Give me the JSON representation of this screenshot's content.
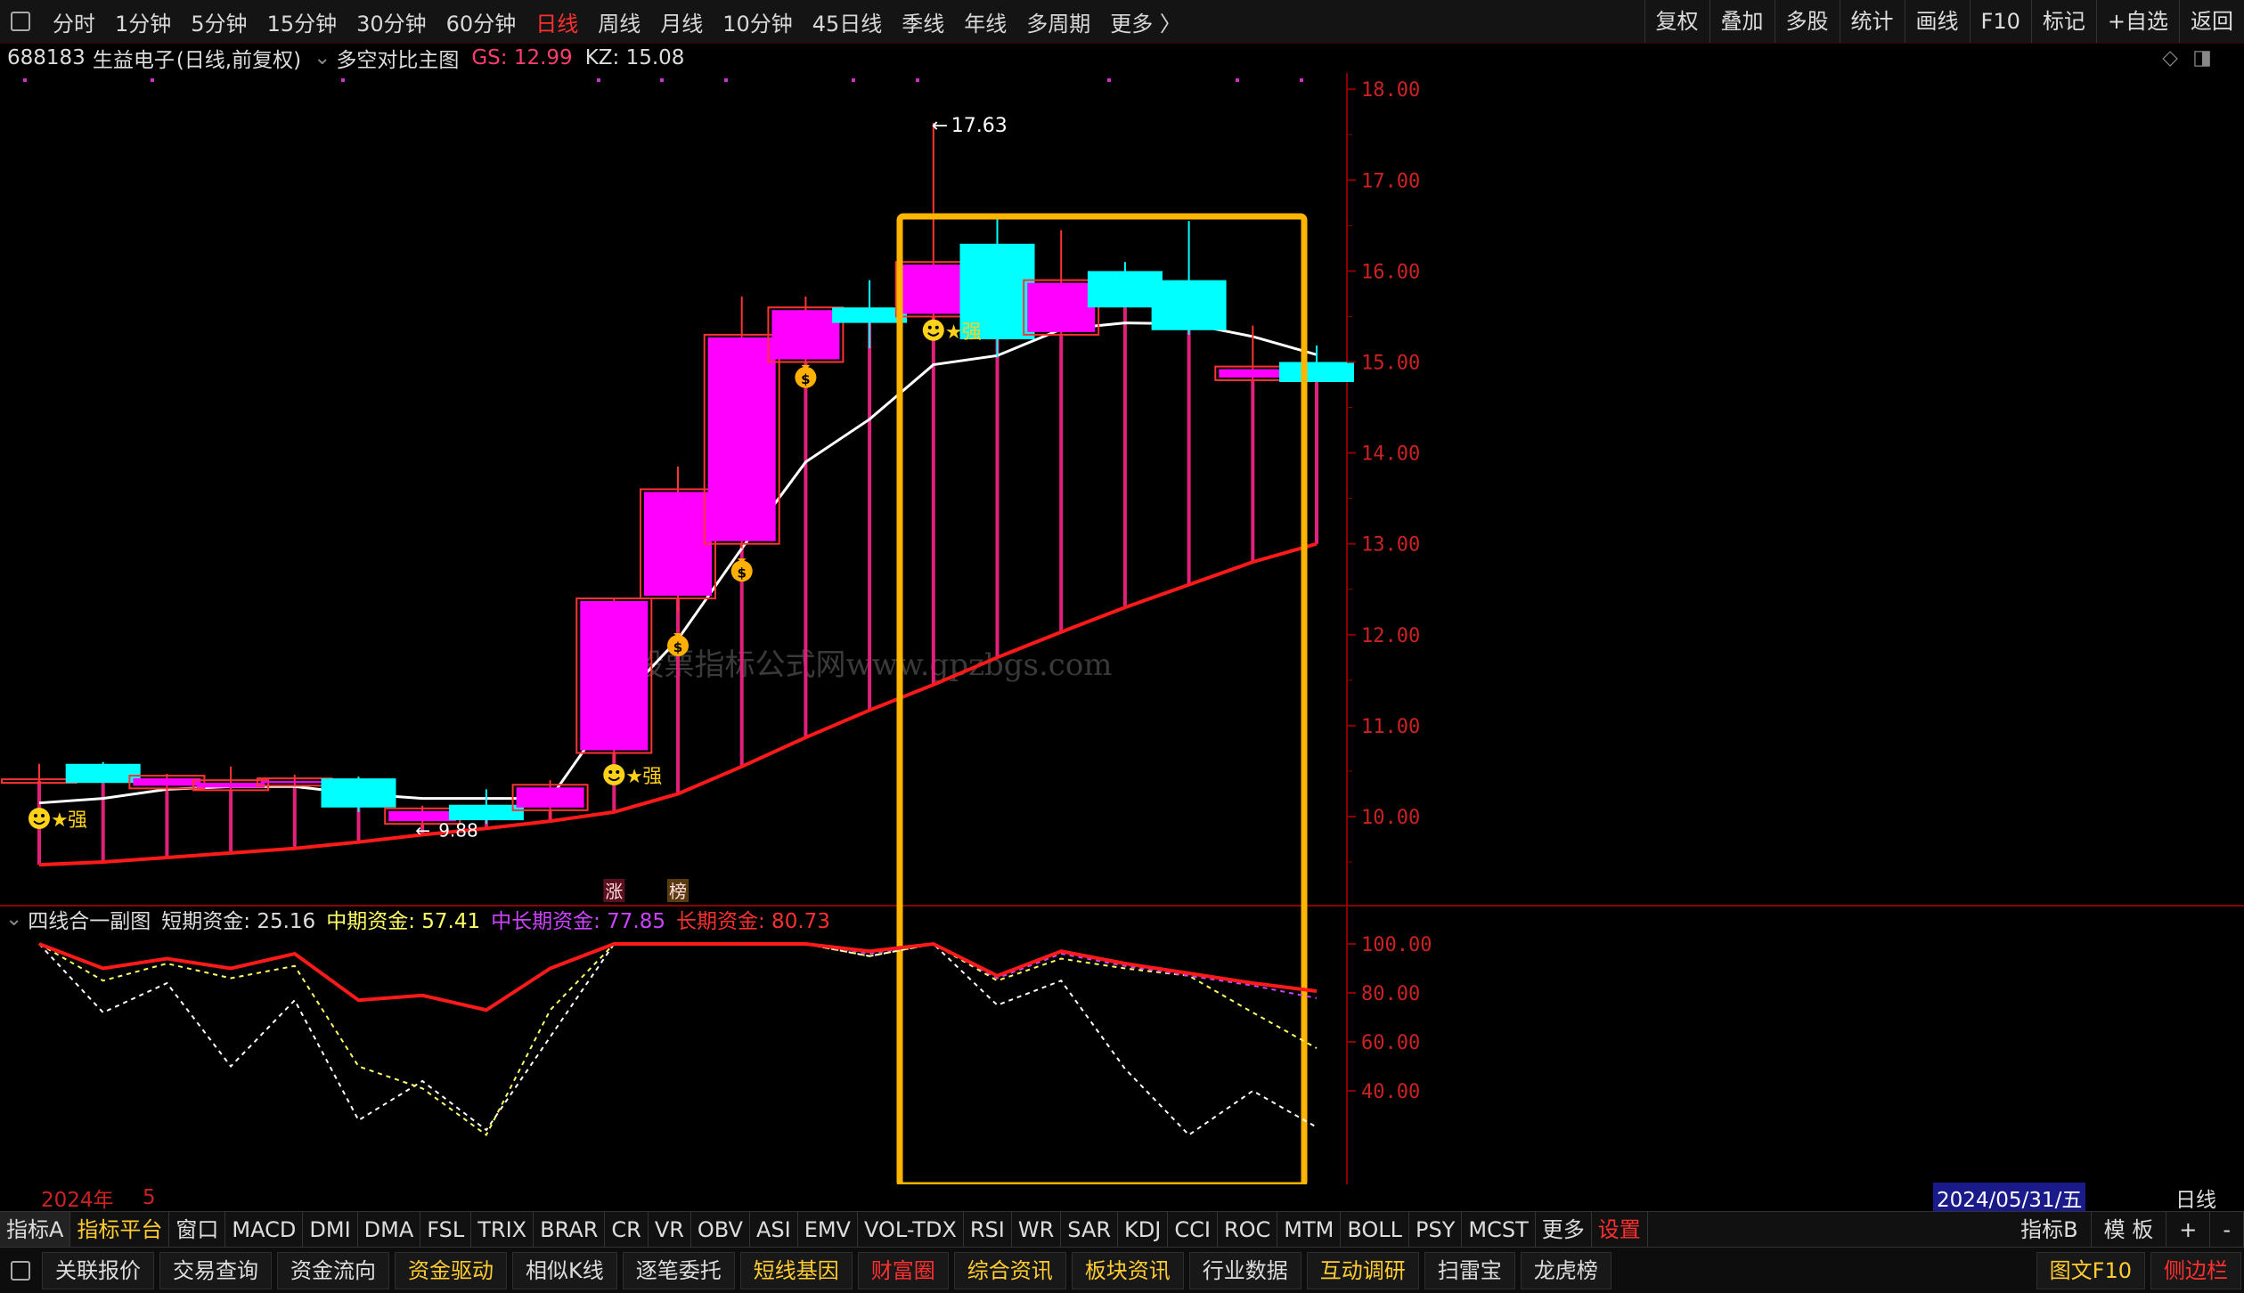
{
  "topbar": {
    "periods": [
      "分时",
      "1分钟",
      "5分钟",
      "15分钟",
      "30分钟",
      "60分钟",
      "日线",
      "周线",
      "月线",
      "10分钟",
      "45日线",
      "季线",
      "年线",
      "多周期",
      "更多 〉"
    ],
    "active_index": 6,
    "right": [
      "复权",
      "叠加",
      "多股",
      "统计",
      "画线",
      "F10",
      "标记",
      "+自选",
      "返回"
    ]
  },
  "info": {
    "code": "688183",
    "name": "生益电子",
    "mode": "(日线,前复权)",
    "indicator": "多空对比主图",
    "gs": "GS: 12.99",
    "kz": "KZ: 15.08"
  },
  "annotations": {
    "high_label": "17.63",
    "low_label": "9.88",
    "qiang": "强",
    "zhang": "涨",
    "bang": "榜",
    "watermark": "股票指标公式网www.gpzbgs.com"
  },
  "subinfo": {
    "name": "四线合一副图",
    "s1": "短期资金: 25.16",
    "s2": "中期资金: 57.41",
    "s3": "中长期资金: 77.85",
    "s4": "长期资金: 80.73"
  },
  "datebar": {
    "year": "2024年",
    "month": "5",
    "current": "2024/05/31/五",
    "period": "日线"
  },
  "tabs": [
    "指标A",
    "指标平台",
    "窗口",
    "MACD",
    "DMI",
    "DMA",
    "FSL",
    "TRIX",
    "BRAR",
    "CR",
    "VR",
    "OBV",
    "ASI",
    "EMV",
    "VOL-TDX",
    "RSI",
    "WR",
    "SAR",
    "KDJ",
    "CCI",
    "ROC",
    "MTM",
    "BOLL",
    "PSY",
    "MCST",
    "更多",
    "设置"
  ],
  "tabs_right": [
    "指标B",
    "模 板",
    "+",
    "-"
  ],
  "bottom_buttons": [
    "关联报价",
    "交易查询",
    "资金流向",
    "资金驱动",
    "相似K线",
    "逐笔委托",
    "短线基因",
    "财富圈",
    "综合资讯",
    "板块资讯",
    "行业数据",
    "互动调研",
    "扫雷宝",
    "龙虎榜"
  ],
  "bottom_right": [
    "图文F10",
    "侧边栏"
  ],
  "chart_data": {
    "type": "candlestick",
    "y_axis_main": [
      18,
      17,
      16,
      15,
      14,
      13,
      12,
      11,
      10
    ],
    "y_axis_sub": [
      100,
      80,
      60,
      40
    ],
    "candles": [
      {
        "o": 10.39,
        "h": 10.58,
        "l": 10.35,
        "c": 10.41,
        "dir": "up"
      },
      {
        "o": 10.58,
        "h": 10.6,
        "l": 10.37,
        "c": 10.37,
        "dir": "down"
      },
      {
        "o": 10.31,
        "h": 10.47,
        "l": 10.28,
        "c": 10.45,
        "dir": "up"
      },
      {
        "o": 10.29,
        "h": 10.55,
        "l": 10.28,
        "c": 10.4,
        "dir": "up"
      },
      {
        "o": 10.34,
        "h": 10.46,
        "l": 10.33,
        "c": 10.42,
        "dir": "up"
      },
      {
        "o": 10.42,
        "h": 10.44,
        "l": 10.05,
        "c": 10.1,
        "dir": "down"
      },
      {
        "o": 9.92,
        "h": 10.12,
        "l": 9.88,
        "c": 10.09,
        "dir": "up"
      },
      {
        "o": 10.13,
        "h": 10.3,
        "l": 9.92,
        "c": 9.96,
        "dir": "down"
      },
      {
        "o": 10.07,
        "h": 10.4,
        "l": 9.98,
        "c": 10.35,
        "dir": "up"
      },
      {
        "o": 10.7,
        "h": 12.4,
        "l": 10.6,
        "c": 12.4,
        "dir": "up"
      },
      {
        "o": 12.4,
        "h": 13.85,
        "l": 12.25,
        "c": 13.6,
        "dir": "up"
      },
      {
        "o": 13.0,
        "h": 15.72,
        "l": 12.95,
        "c": 15.3,
        "dir": "up"
      },
      {
        "o": 15.0,
        "h": 15.72,
        "l": 15.0,
        "c": 15.6,
        "dir": "up"
      },
      {
        "o": 15.6,
        "h": 15.9,
        "l": 15.15,
        "c": 15.43,
        "dir": "down"
      },
      {
        "o": 15.5,
        "h": 17.63,
        "l": 15.45,
        "c": 16.1,
        "dir": "up"
      },
      {
        "o": 16.3,
        "h": 16.6,
        "l": 15.05,
        "c": 15.25,
        "dir": "down"
      },
      {
        "o": 15.3,
        "h": 16.45,
        "l": 15.3,
        "c": 15.9,
        "dir": "up"
      },
      {
        "o": 16.0,
        "h": 16.1,
        "l": 15.6,
        "c": 15.6,
        "dir": "down"
      },
      {
        "o": 15.9,
        "h": 16.55,
        "l": 15.3,
        "c": 15.35,
        "dir": "down"
      },
      {
        "o": 14.8,
        "h": 15.4,
        "l": 14.8,
        "c": 14.95,
        "dir": "up"
      },
      {
        "o": 15.0,
        "h": 15.18,
        "l": 14.78,
        "c": 14.78,
        "dir": "down"
      }
    ],
    "white_line": [
      10.15,
      10.2,
      10.3,
      10.33,
      10.33,
      10.25,
      10.2,
      10.2,
      10.2,
      11.2,
      11.95,
      12.95,
      13.9,
      14.37,
      14.97,
      15.07,
      15.36,
      15.43,
      15.42,
      15.28,
      15.08
    ],
    "red_line": [
      9.47,
      9.5,
      9.55,
      9.6,
      9.65,
      9.72,
      9.8,
      9.87,
      9.95,
      10.05,
      10.25,
      10.55,
      10.87,
      11.17,
      11.45,
      11.75,
      12.03,
      12.3,
      12.55,
      12.8,
      13.0
    ],
    "icons": [
      {
        "i": 0,
        "type": "smile",
        "v": 9.98
      },
      {
        "i": 9,
        "type": "smile",
        "v": 10.46
      },
      {
        "i": 10,
        "type": "bag",
        "v": 11.9
      },
      {
        "i": 11,
        "type": "bag",
        "v": 12.72
      },
      {
        "i": 12,
        "type": "bag",
        "v": 14.85
      },
      {
        "i": 14,
        "type": "smile",
        "v": 15.35
      }
    ],
    "sub_red": [
      100,
      90,
      94,
      90,
      96,
      77,
      79,
      73,
      90,
      100,
      100,
      100,
      100,
      97,
      100,
      87,
      97,
      92,
      88,
      84,
      80.73
    ],
    "sub_yellow": [
      100,
      85,
      92,
      86,
      91,
      50,
      41,
      22,
      73,
      100,
      100,
      100,
      100,
      95,
      100,
      85,
      94,
      90,
      87,
      72,
      57.41
    ],
    "sub_white": [
      100,
      72,
      84,
      50,
      77,
      28,
      44,
      24,
      62,
      100,
      100,
      100,
      100,
      95,
      100,
      75,
      85,
      49,
      22,
      40,
      25.16
    ],
    "sub_purple": [
      100,
      90,
      94,
      90,
      96,
      77,
      79,
      73,
      90,
      100,
      100,
      100,
      100,
      96,
      100,
      86,
      96,
      91,
      87,
      83,
      77.85
    ]
  }
}
